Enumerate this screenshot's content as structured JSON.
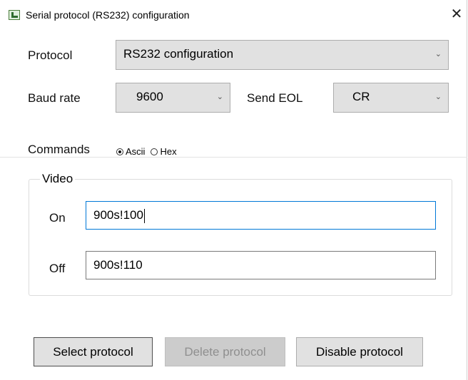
{
  "window": {
    "title": "Serial protocol (RS232) configuration",
    "close_glyph": "✕",
    "app_icon": "serial-port-icon"
  },
  "protocol": {
    "label": "Protocol",
    "selected": "RS232 configuration"
  },
  "baud_rate": {
    "label": "Baud rate",
    "selected": "9600"
  },
  "send_eol": {
    "label": "Send EOL",
    "selected": "CR"
  },
  "commands": {
    "label": "Commands",
    "options": [
      {
        "label": "Ascii",
        "checked": true
      },
      {
        "label": "Hex",
        "checked": false
      }
    ]
  },
  "video": {
    "group_title": "Video",
    "on": {
      "label": "On",
      "value": "900s!100"
    },
    "off": {
      "label": "Off",
      "value": "900s!110"
    }
  },
  "buttons": {
    "select": "Select protocol",
    "delete": "Delete protocol",
    "disable": "Disable protocol"
  },
  "chevron_glyph": "⌄",
  "colors": {
    "focus_border": "#0078d7",
    "button_bg": "#e1e1e1",
    "disabled_text": "#8f8f8f"
  }
}
